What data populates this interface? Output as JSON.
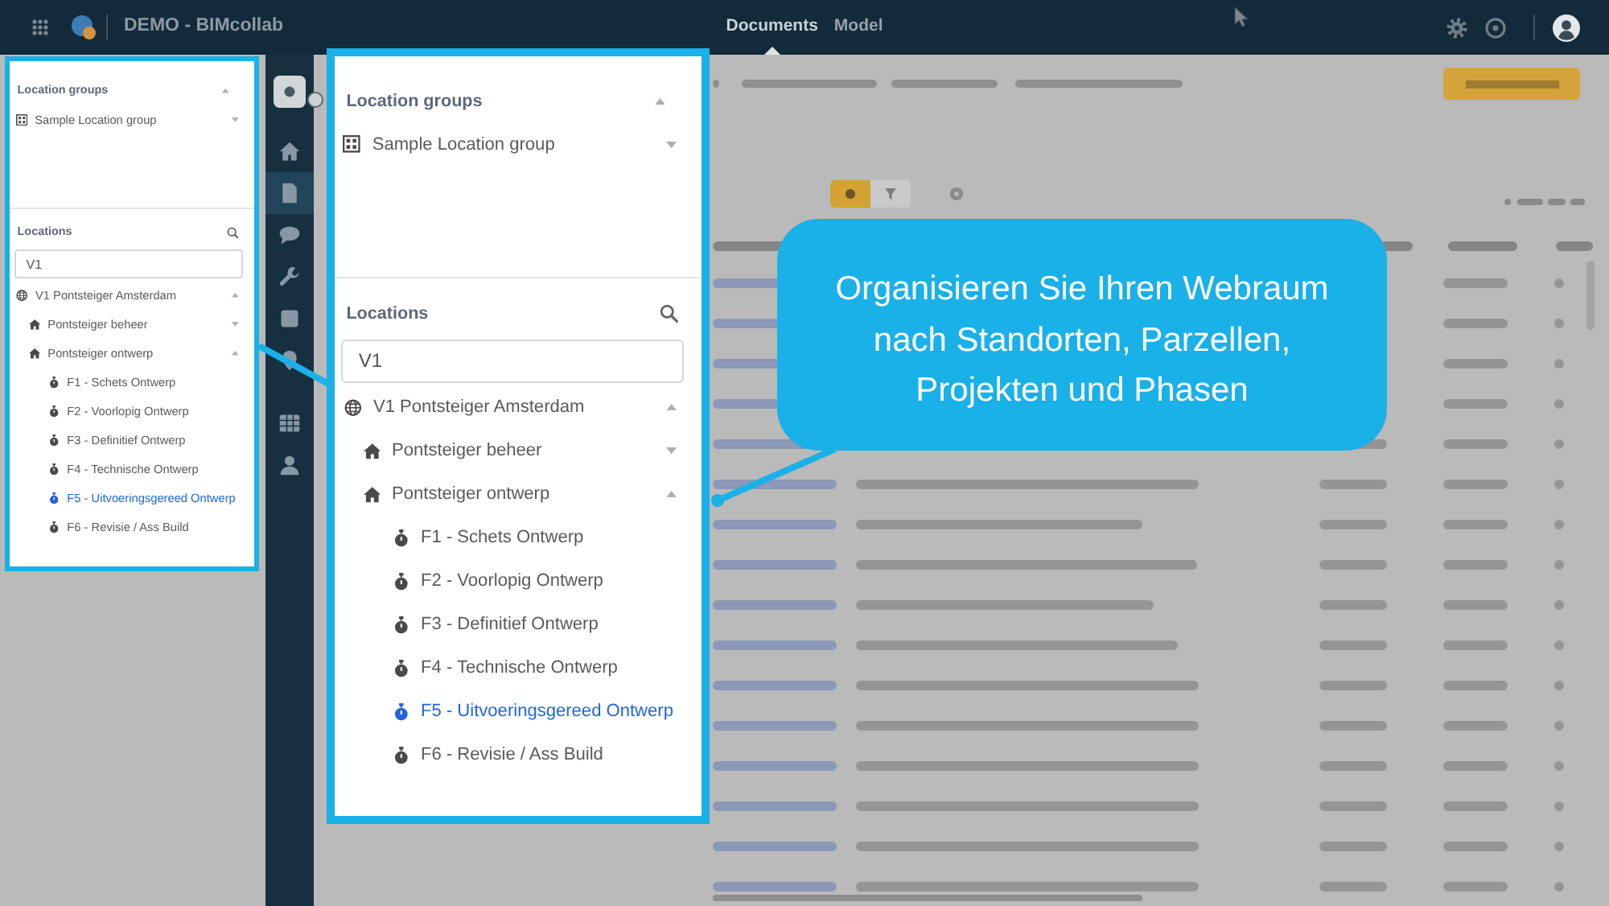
{
  "top_bar": {
    "app_title": "DEMO - BIMcollab",
    "tabs": [
      {
        "label": "Documents",
        "selected": true
      },
      {
        "label": "Model",
        "selected": false
      }
    ]
  },
  "side_nav": {
    "groups": [
      {
        "items": [
          {
            "kind": "tile",
            "selected": false
          }
        ]
      },
      {
        "items": [
          {
            "kind": "home",
            "selected": false
          },
          {
            "kind": "documents",
            "selected": true
          },
          {
            "kind": "chat",
            "selected": false
          },
          {
            "kind": "tools",
            "selected": false
          },
          {
            "kind": "box",
            "selected": false
          },
          {
            "kind": "pin",
            "selected": false
          }
        ]
      },
      {
        "items": [
          {
            "kind": "table",
            "selected": false
          },
          {
            "kind": "user",
            "selected": false
          }
        ]
      }
    ]
  },
  "locations_panel": {
    "location_groups": {
      "title": "Location groups",
      "expanded": true,
      "items": [
        {
          "label": "Sample Location group",
          "expanded": false,
          "selected": false
        }
      ]
    },
    "locations": {
      "title": "Locations",
      "search": {
        "value": "V1"
      },
      "tree": [
        {
          "kind": "project",
          "label": "V1 Pontsteiger Amsterdam",
          "expanded": true,
          "selected": false,
          "children": [
            {
              "kind": "site",
              "label": "Pontsteiger beheer",
              "expanded": false,
              "selected": false
            },
            {
              "kind": "site",
              "label": "Pontsteiger ontwerp",
              "expanded": true,
              "selected": false,
              "children": [
                {
                  "kind": "phase",
                  "label": "F1 - Schets Ontwerp",
                  "selected": false
                },
                {
                  "kind": "phase",
                  "label": "F2 - Voorlopig Ontwerp",
                  "selected": false
                },
                {
                  "kind": "phase",
                  "label": "F3 - Definitief Ontwerp",
                  "selected": false
                },
                {
                  "kind": "phase",
                  "label": "F4 - Technische Ontwerp",
                  "selected": false
                },
                {
                  "kind": "phase",
                  "label": "F5 - Uitvoeringsgereed Ontwerp",
                  "selected": true
                },
                {
                  "kind": "phase",
                  "label": "F6 - Revisie / Ass Build",
                  "selected": false
                }
              ]
            }
          ]
        }
      ]
    }
  },
  "zoomed_panel": {
    "location_groups": {
      "title": "Location groups",
      "expanded": true,
      "items": [
        {
          "label": "Sample Location group",
          "expanded": false,
          "selected": false
        }
      ]
    },
    "locations": {
      "title": "Locations",
      "search": {
        "value": "V1"
      },
      "tree": [
        {
          "kind": "project",
          "label": "V1 Pontsteiger Amsterdam",
          "expanded": true,
          "selected": false,
          "children": [
            {
              "kind": "site",
              "label": "Pontsteiger beheer",
              "expanded": false,
              "selected": false
            },
            {
              "kind": "site",
              "label": "Pontsteiger ontwerp",
              "expanded": true,
              "selected": false,
              "children": [
                {
                  "kind": "phase",
                  "label": "F1 - Schets Ontwerp",
                  "selected": false
                },
                {
                  "kind": "phase",
                  "label": "F2 - Voorlopig Ontwerp",
                  "selected": false
                },
                {
                  "kind": "phase",
                  "label": "F3 - Definitief Ontwerp",
                  "selected": false
                },
                {
                  "kind": "phase",
                  "label": "F4 - Technische Ontwerp",
                  "selected": false
                },
                {
                  "kind": "phase",
                  "label": "F5 - Uitvoeringsgereed Ontwerp",
                  "selected": true
                },
                {
                  "kind": "phase",
                  "label": "F6 - Revisie / Ass Build",
                  "selected": false
                }
              ]
            }
          ]
        }
      ]
    }
  },
  "callout": {
    "lines": [
      "Organisieren Sie Ihren Webraum",
      "nach Standorten, Parzellen,",
      "Projekten und Phasen"
    ]
  }
}
